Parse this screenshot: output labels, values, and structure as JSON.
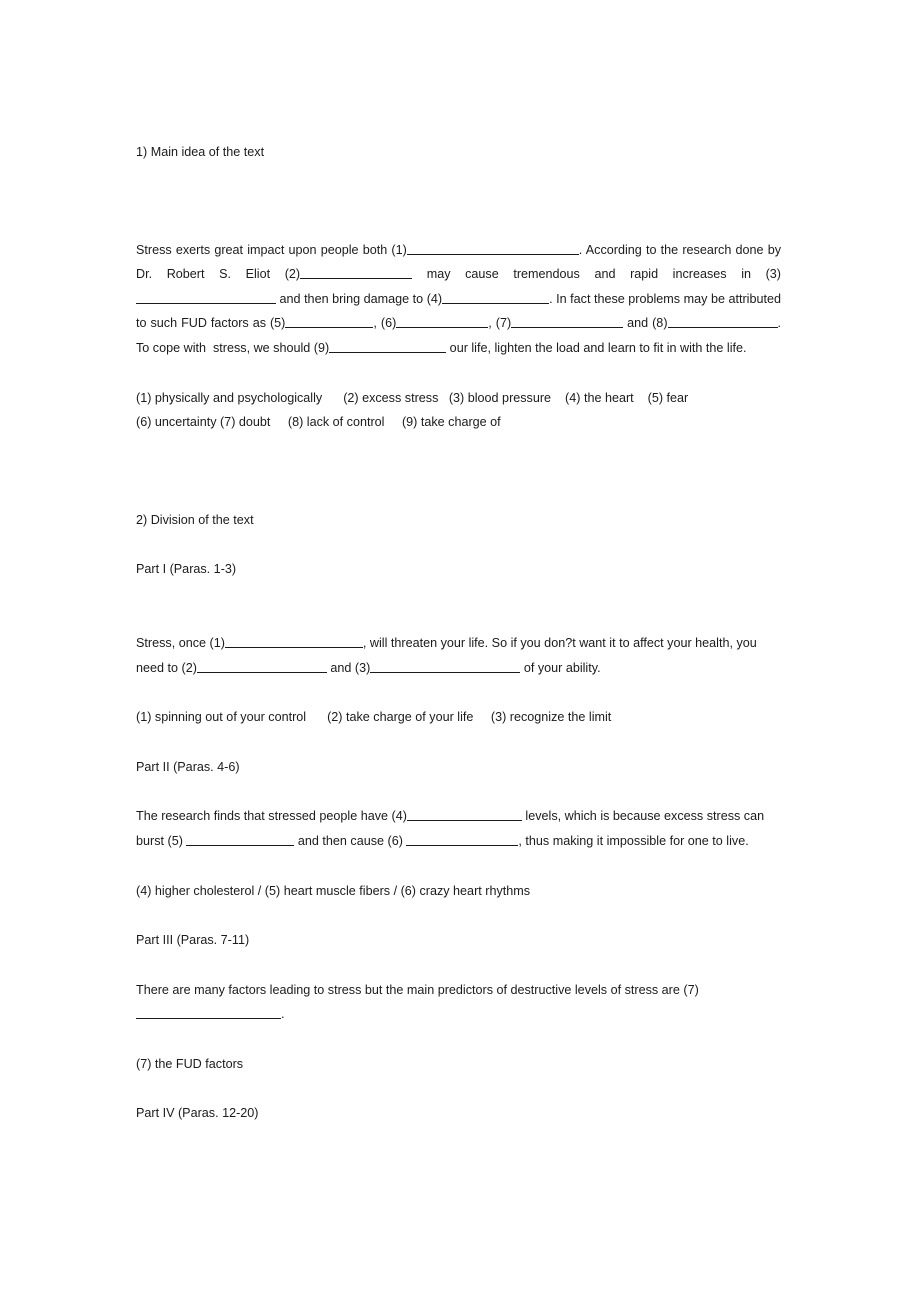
{
  "document": {
    "sections": [
      {
        "id": "main-idea",
        "heading": "1) Main idea of the text",
        "passage_parts": {
          "p1": "Stress exerts great impact upon people both (1)",
          "p2": ". According to the research done by Dr. Robert S. Eliot (2)",
          "p3": " may cause tremendous and rapid increases in (3)",
          "p4": " and then bring damage to (4)",
          "p5": ". In fact these problems may be attributed to such FUD factors as (5)",
          "p6": ", (6)",
          "p7": ", (7)",
          "p8": " and (8)",
          "p9": ". To cope with  stress, we should (9)",
          "p10": " our life, lighten the load and learn to fit in with the life."
        },
        "answers_line_1": "(1) physically and psychologically      (2) excess stress   (3) blood pressure    (4) the heart    (5) fear",
        "answers_line_2": "(6) uncertainty (7) doubt     (8) lack of control     (9) take charge of"
      },
      {
        "id": "division",
        "heading": "2) Division of the text",
        "parts": [
          {
            "label": "Part I (Paras. 1-3)",
            "passage_parts": {
              "p1": "Stress, once (1)",
              "p2": ", will threaten your life. So if you don?t want it to affect your health, you need to (2)",
              "p3": " and (3)",
              "p4": " of your ability."
            },
            "answers": "(1) spinning out of your control      (2) take charge of your life     (3) recognize the limit"
          },
          {
            "label": "Part II (Paras. 4-6)",
            "passage_parts": {
              "p1": "The research finds that stressed people have (4)",
              "p2": " levels, which is because excess stress can burst (5) ",
              "p3": " and then cause (6) ",
              "p4": ", thus making it impossible for one to live."
            },
            "answers": "(4) higher cholesterol / (5) heart muscle fibers / (6) crazy heart rhythms"
          },
          {
            "label": "Part III (Paras. 7-11)",
            "passage_parts": {
              "p1": "There are many factors leading to stress but the main predictors of destructive levels of stress are (7) ",
              "p2": "."
            },
            "answers": "(7) the FUD factors"
          },
          {
            "label": "Part IV (Paras. 12-20)"
          }
        ]
      }
    ]
  }
}
